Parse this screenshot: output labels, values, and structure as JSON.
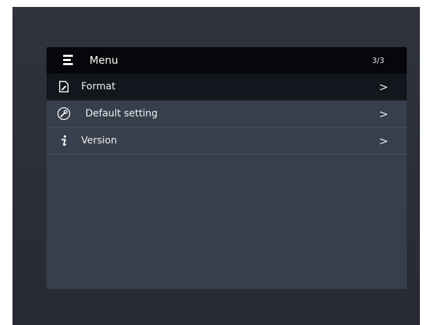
{
  "header": {
    "title": "Menu",
    "page_indicator": "3/3",
    "icon": "menu-icon"
  },
  "items": [
    {
      "label": "Format",
      "icon": "file-edit-icon",
      "selected": true
    },
    {
      "label": "Default setting",
      "icon": "wrench-icon",
      "selected": false
    },
    {
      "label": "Version",
      "icon": "info-icon",
      "selected": false
    }
  ],
  "chevron": ">",
  "colors": {
    "header_bg": "#06070a",
    "selected_bg": "#13161c",
    "panel_bg": "#373f4c",
    "screen_bg": "#2b2e37",
    "text": "#f0f0f0"
  }
}
